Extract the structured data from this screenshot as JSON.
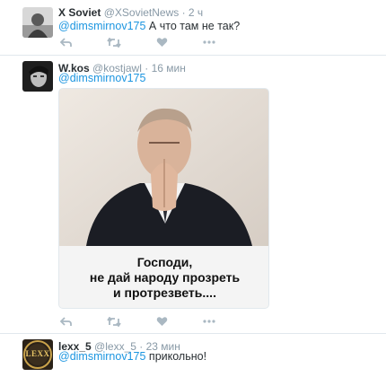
{
  "colors": {
    "link": "#1b95e0",
    "meta": "#8899a6",
    "text": "#292f33",
    "divider": "#e1e8ed",
    "icon": "#aab8c2"
  },
  "tweets": [
    {
      "name": "X Soviet",
      "handle": "@XSovietNews",
      "time": "· 2 ч",
      "mention": "@dimsmirnov175",
      "text": " А что там не так?",
      "avatar_icon": "soldier-photo-avatar"
    },
    {
      "name": "W.kos",
      "handle": "@kostjawl",
      "time": "· 16 мин",
      "mention": "@dimsmirnov175",
      "text": "",
      "avatar_icon": "face-photo-avatar",
      "media": {
        "caption_lines": [
          "Господи,",
          "не дай народу прозреть",
          "и протрезветь...."
        ]
      }
    },
    {
      "name": "lexx_5",
      "handle": "@lexx_5",
      "time": "· 23 мин",
      "mention": "@dimsmirnov175",
      "text": " прикольно!",
      "avatar_icon": "lexx-logo-avatar",
      "avatar_text": "LEXX"
    }
  ]
}
